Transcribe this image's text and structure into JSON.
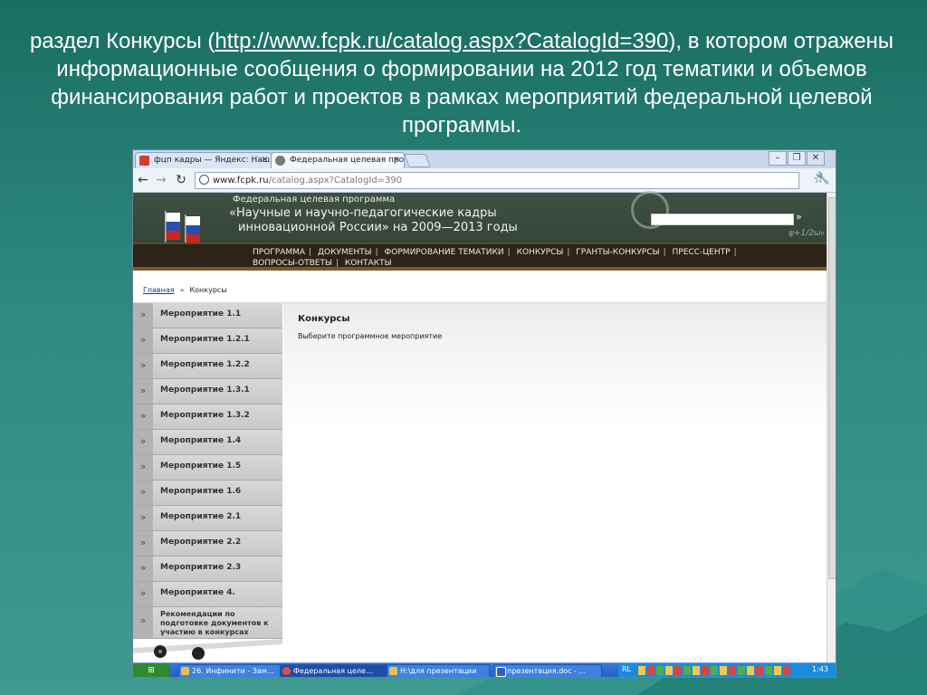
{
  "slide": {
    "caption_prefix": "раздел Конкурсы (",
    "caption_link": "http://www.fcpk.ru/catalog.aspx?CatalogId=390",
    "caption_suffix": "), в котором отражены  информационные сообщения о формировании на 2012 год тематики и объемов финансирования работ и проектов в рамках мероприятий федеральной целевой программы."
  },
  "browser": {
    "tabs": [
      {
        "label": "фцп кадры — Яндекс: Нашл",
        "favicon_color": "#d43b2f"
      },
      {
        "label": "Федеральная целевая прогр",
        "favicon_color": "#7a7a7a"
      }
    ],
    "address": {
      "domain": "www.fcpk.ru",
      "path": "/catalog.aspx?CatalogId=390"
    }
  },
  "site": {
    "header": {
      "line1": "Федеральная целевая программа",
      "line2": "«Научные и научно-педагогические кадры",
      "line3": "инновационной России» на 2009—2013 годы",
      "search_go": "»",
      "formula": "ψ+1/2ω₀"
    },
    "nav": [
      "ПРОГРАММА",
      "ДОКУМЕНТЫ",
      "ФОРМИРОВАНИЕ ТЕМАТИКИ",
      "КОНКУРСЫ",
      "ГРАНТЫ-КОНКУРСЫ",
      "ПРЕСС-ЦЕНТР",
      "ВОПРОСЫ-ОТВЕТЫ",
      "КОНТАКТЫ"
    ],
    "breadcrumb": {
      "home": "Главная",
      "arrow": "»",
      "current": "Конкурсы"
    },
    "sidebar": [
      "Мероприятие 1.1",
      "Мероприятие 1.2.1",
      "Мероприятие 1.2.2",
      "Мероприятие 1.3.1",
      "Мероприятие 1.3.2",
      "Мероприятие 1.4",
      "Мероприятие 1.5",
      "Мероприятие 1.6",
      "Мероприятие 2.1",
      "Мероприятие 2.2",
      "Мероприятие 2.3",
      "Мероприятие 4.",
      "Рекомендации по подготовке документов к участию в конкурсах"
    ],
    "sidebar_bullet": "»",
    "content": {
      "title": "Конкурсы",
      "text": "Выберите программное мероприятие"
    }
  },
  "taskbar": {
    "items": [
      "26. Инфинити - Зам...",
      "Федеральная целе...",
      "H:\\для презентации",
      "презентация.doc - ..."
    ],
    "lang": "RL",
    "clock": "1:43"
  }
}
